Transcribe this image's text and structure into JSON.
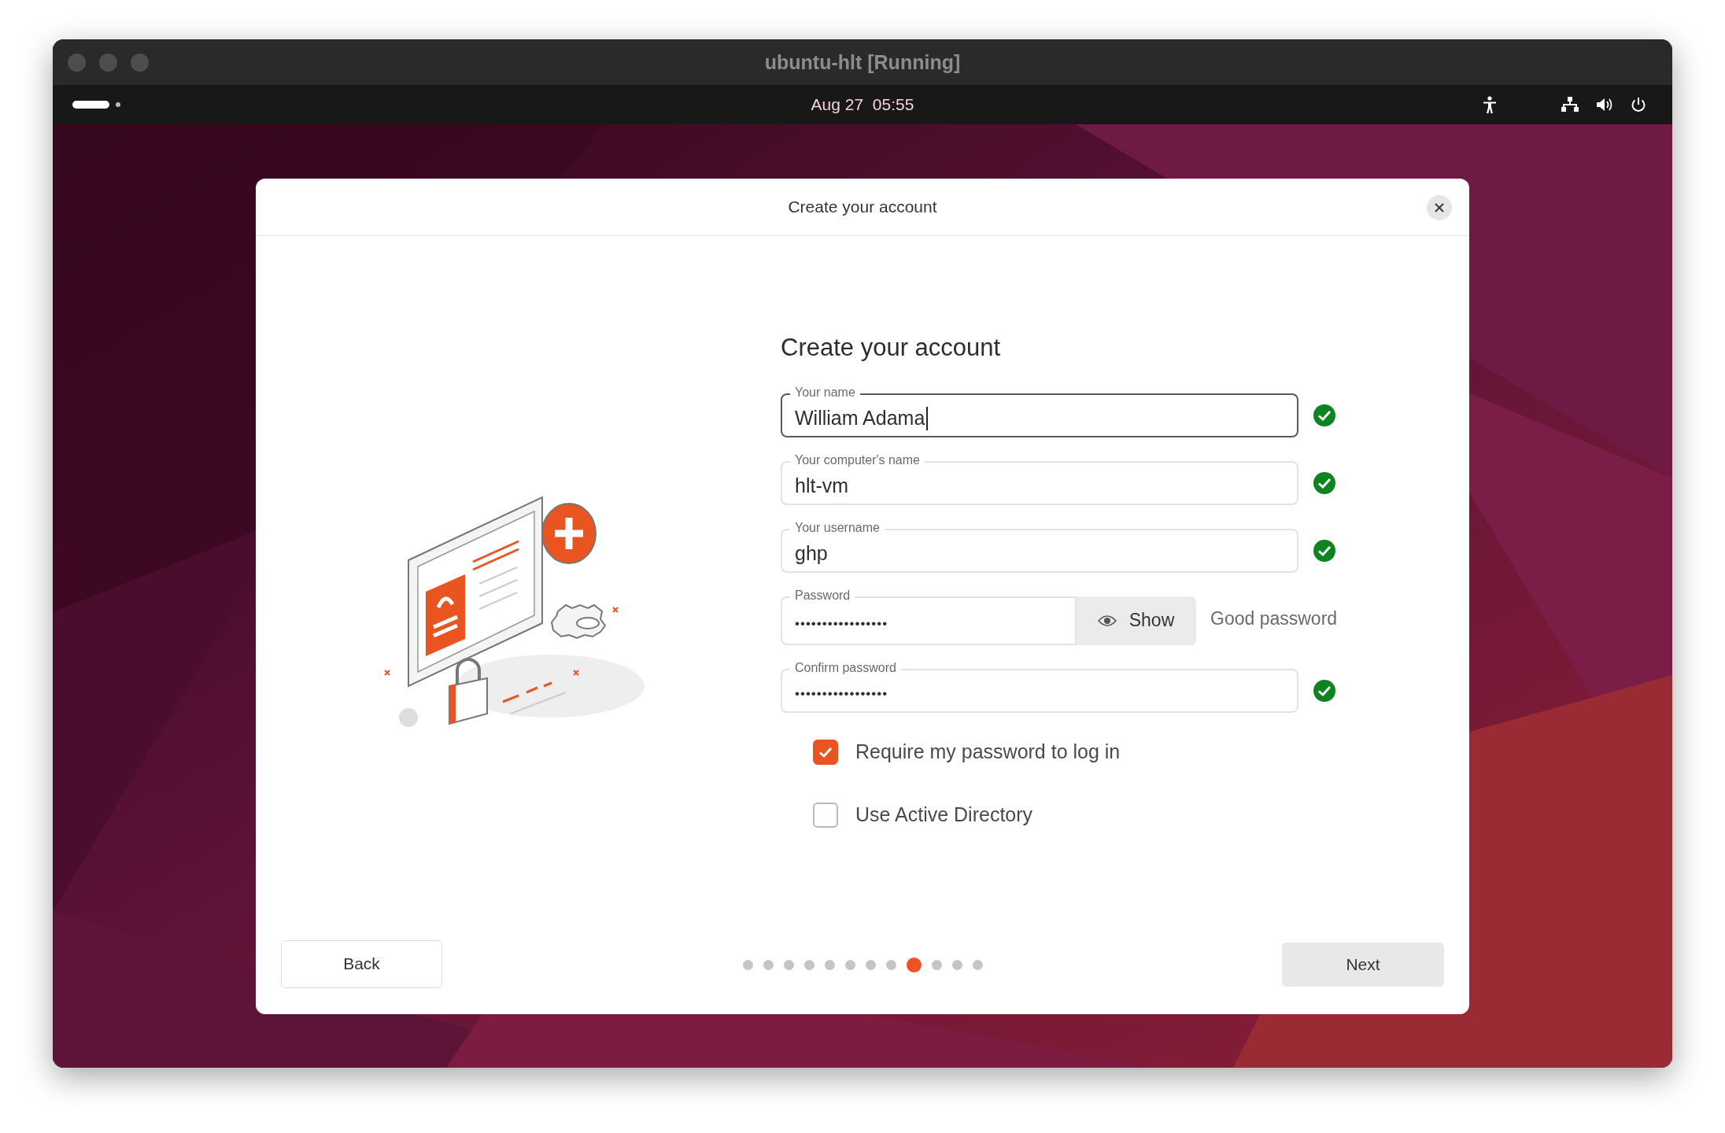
{
  "window": {
    "title": "ubuntu-hlt [Running]"
  },
  "top_bar": {
    "clock": "Aug 27  05:55"
  },
  "dialog": {
    "title": "Create your account",
    "heading": "Create your account",
    "fields": [
      {
        "kind": "text",
        "label": "Your name",
        "value": "William Adama",
        "focused": true,
        "valid": true
      },
      {
        "kind": "text",
        "label": "Your computer's name",
        "value": "hlt-vm",
        "focused": false,
        "valid": true
      },
      {
        "kind": "text",
        "label": "Your username",
        "value": "ghp",
        "focused": false,
        "valid": true
      },
      {
        "kind": "password",
        "label": "Password",
        "value": "•••••••••••••••••",
        "focused": false,
        "valid": false,
        "show_button": "Show",
        "strength": "Good password"
      },
      {
        "kind": "text",
        "label": "Confirm password",
        "value": "•••••••••••••••••",
        "focused": false,
        "valid": true
      }
    ],
    "checkboxes": [
      {
        "label": "Require my password to log in",
        "checked": true
      },
      {
        "label": "Use Active Directory",
        "checked": false
      }
    ],
    "back_button": "Back",
    "next_button": "Next",
    "steps": [
      {
        "selected": false
      },
      {
        "selected": false
      },
      {
        "selected": false
      },
      {
        "selected": false
      },
      {
        "selected": false
      },
      {
        "selected": false
      },
      {
        "selected": false
      },
      {
        "selected": false
      },
      {
        "selected": true
      },
      {
        "selected": false
      },
      {
        "selected": false
      },
      {
        "selected": false
      }
    ]
  }
}
